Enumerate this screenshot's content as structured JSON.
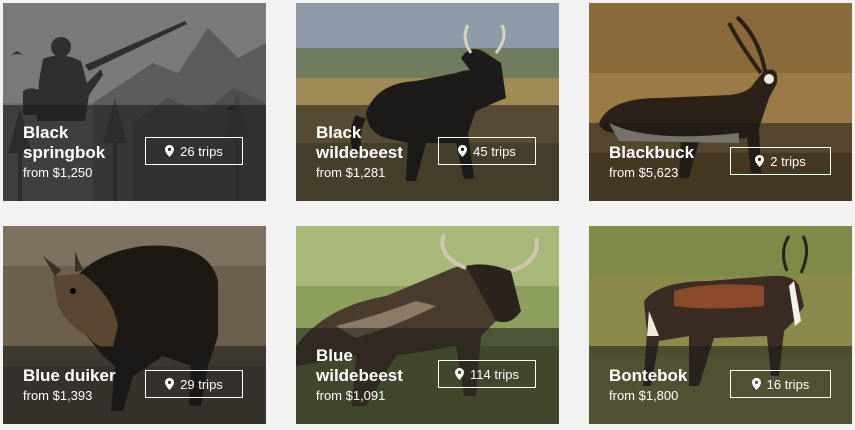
{
  "cards": [
    {
      "name": "Black\nspringbok",
      "price": "from $1,250",
      "trips": "26 trips",
      "icon": "map-pin-icon"
    },
    {
      "name": "Black\nwildebeest",
      "price": "from $1,281",
      "trips": "45 trips",
      "icon": "map-pin-icon"
    },
    {
      "name": "Blackbuck",
      "price": "from $5,623",
      "trips": "2 trips",
      "icon": "map-pin-icon"
    },
    {
      "name": "Blue duiker",
      "price": "from $1,393",
      "trips": "29 trips",
      "icon": "map-pin-icon"
    },
    {
      "name": "Blue\nwildebeest",
      "price": "from $1,091",
      "trips": "114 trips",
      "icon": "map-pin-icon"
    },
    {
      "name": "Bontebok",
      "price": "from $1,800",
      "trips": "16 trips",
      "icon": "map-pin-icon"
    }
  ]
}
